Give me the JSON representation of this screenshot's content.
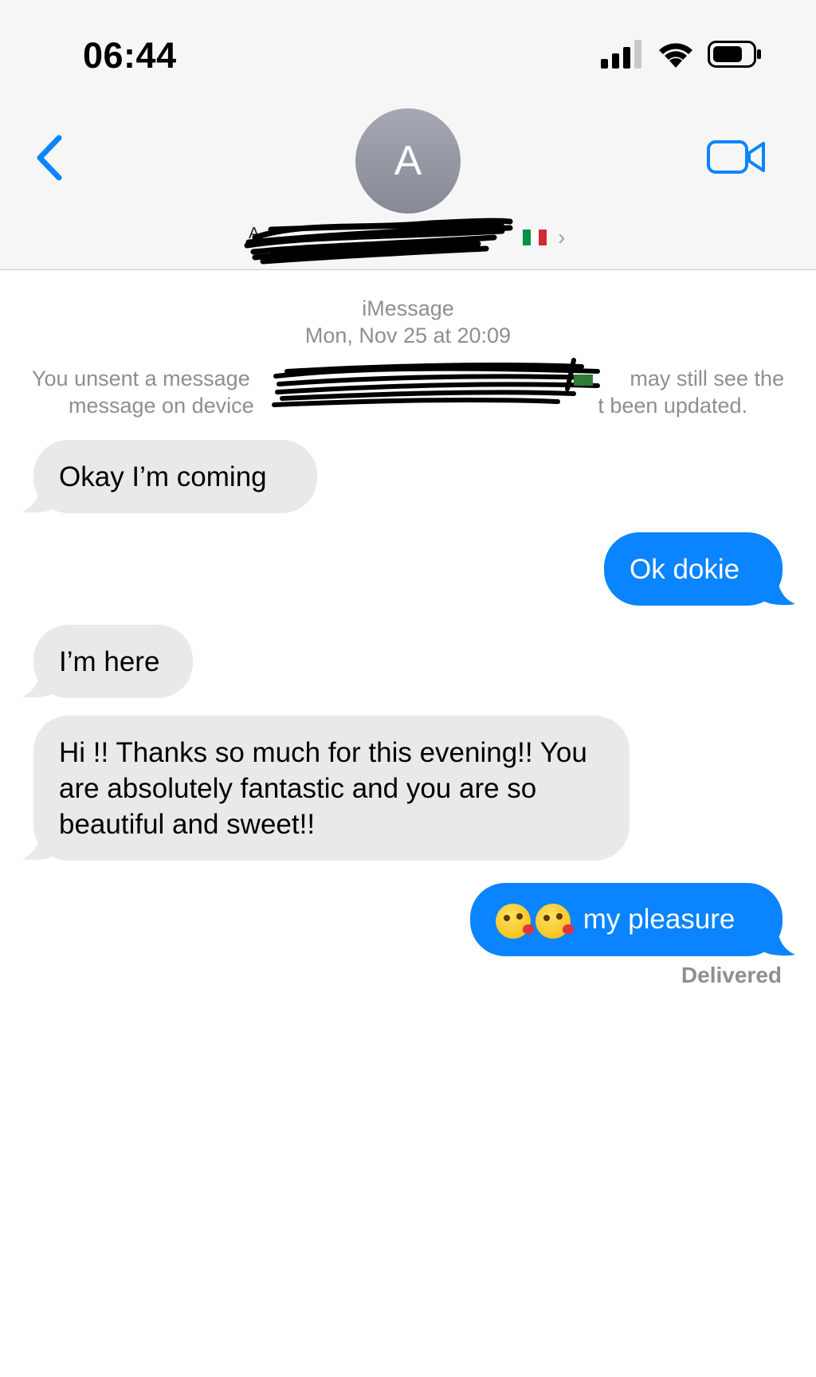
{
  "status_bar": {
    "time": "06:44",
    "icons": [
      "signal-icon",
      "wifi-icon",
      "battery-icon"
    ]
  },
  "header": {
    "back_icon": "chevron-left-icon",
    "avatar_initial": "A",
    "contact_name": "A",
    "flag_icon": "italy-flag-icon",
    "chevron_icon": "chevron-right-icon",
    "video_icon": "video-camera-icon",
    "accent_color": "#0a84ff"
  },
  "thread": {
    "service": "iMessage",
    "timestamp": "Mon, Nov 25 at 20:09",
    "unsent_note_start": "You unsent a message",
    "unsent_note_tail_1": "may still see the",
    "unsent_note_line_2_start": "message on device",
    "unsent_note_line_2_end": "t been updated.",
    "messages": [
      {
        "direction": "incoming",
        "text": "Okay I’m coming"
      },
      {
        "direction": "outgoing",
        "text": "Ok dokie"
      },
      {
        "direction": "incoming",
        "text": "I’m here"
      },
      {
        "direction": "incoming",
        "text": "Hi !! Thanks so much for this evening!! You are absolutely fantastic and you are so beautiful and sweet!!"
      },
      {
        "direction": "outgoing",
        "text": "my pleasure",
        "emoji": [
          "kissing-face-icon",
          "kissing-face-icon"
        ]
      }
    ],
    "delivery_status": "Delivered",
    "incoming_color": "#e9e9eb",
    "outgoing_color": "#0a84ff"
  }
}
